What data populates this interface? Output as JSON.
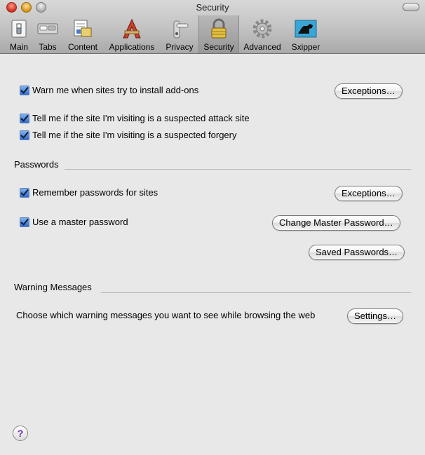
{
  "window": {
    "title": "Security"
  },
  "toolbar": {
    "tabs": [
      {
        "label": "Main",
        "icon": "switch-icon"
      },
      {
        "label": "Tabs",
        "icon": "tabs-icon"
      },
      {
        "label": "Content",
        "icon": "content-icon"
      },
      {
        "label": "Applications",
        "icon": "applications-icon"
      },
      {
        "label": "Privacy",
        "icon": "door-handle-icon"
      },
      {
        "label": "Security",
        "icon": "padlock-icon"
      },
      {
        "label": "Advanced",
        "icon": "gear-icon"
      },
      {
        "label": "Sxipper",
        "icon": "sxipper-dog-icon"
      }
    ],
    "selected": "Security"
  },
  "general": {
    "install_addons": {
      "label": "Warn me when sites try to install add-ons",
      "checked": true
    },
    "install_exceptions": "Exceptions…",
    "attack_site": {
      "label": "Tell me if the site I'm visiting is a suspected attack site",
      "checked": true
    },
    "forgery": {
      "label": "Tell me if the site I'm visiting is a suspected forgery",
      "checked": true
    }
  },
  "passwords": {
    "heading": "Passwords",
    "remember": {
      "label": "Remember passwords for sites",
      "checked": true
    },
    "exceptions": "Exceptions…",
    "master": {
      "label": "Use a master password",
      "checked": true
    },
    "change_master": "Change Master Password…",
    "saved": "Saved Passwords…"
  },
  "warnings": {
    "heading": "Warning Messages",
    "description": "Choose which warning messages you want to see while browsing the web",
    "settings": "Settings…"
  },
  "help": {
    "label": "?"
  },
  "colors": {
    "accent": "#2f6cd0",
    "help": "#6a2fa8"
  }
}
